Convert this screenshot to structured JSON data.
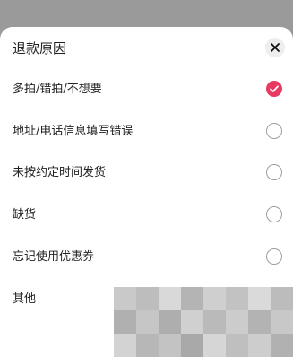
{
  "sheet": {
    "title": "退款原因",
    "options": [
      {
        "label": "多拍/错拍/不想要",
        "selected": true
      },
      {
        "label": "地址/电话信息填写错误",
        "selected": false
      },
      {
        "label": "未按约定时间发货",
        "selected": false
      },
      {
        "label": "缺货",
        "selected": false
      },
      {
        "label": "忘记使用优惠券",
        "selected": false
      },
      {
        "label": "其他",
        "selected": false
      }
    ]
  },
  "colors": {
    "accent": "#e83a61",
    "overlay": "#9a9a9a",
    "radio_border": "#9e9e9e"
  },
  "icons": {
    "close": "close-icon",
    "check": "check-icon"
  }
}
